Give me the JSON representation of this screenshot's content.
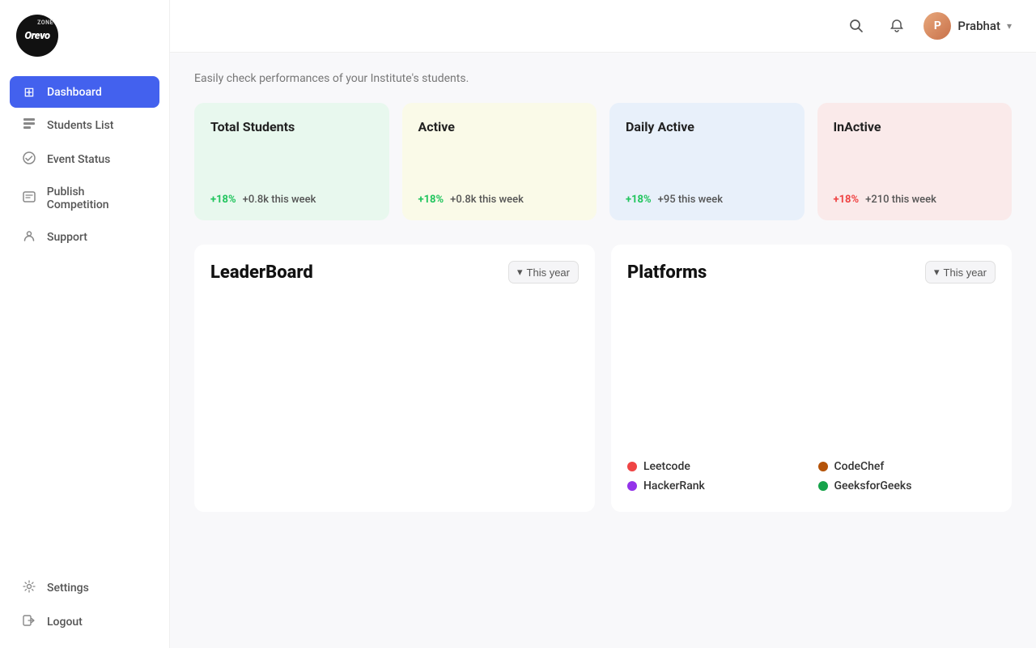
{
  "logo": {
    "text": "Orevo",
    "zone": "ZONE"
  },
  "sidebar": {
    "items": [
      {
        "id": "dashboard",
        "label": "Dashboard",
        "icon": "⊞",
        "active": true
      },
      {
        "id": "students-list",
        "label": "Students List",
        "icon": "≡",
        "active": false
      },
      {
        "id": "event-status",
        "label": "Event Status",
        "icon": "✓",
        "active": false
      },
      {
        "id": "publish-competition",
        "label": "Publish Competition",
        "icon": "▤",
        "active": false
      },
      {
        "id": "support",
        "label": "Support",
        "icon": "👤",
        "active": false
      }
    ],
    "bottom": [
      {
        "id": "settings",
        "label": "Settings",
        "icon": "⚙"
      },
      {
        "id": "logout",
        "label": "Logout",
        "icon": "⇥"
      }
    ]
  },
  "header": {
    "username": "Prabhat",
    "search_title": "Search",
    "bell_title": "Notifications"
  },
  "content": {
    "subtitle": "Easily check performances of your Institute's students.",
    "stats": [
      {
        "id": "total-students",
        "title": "Total Students",
        "pct": "+18%",
        "pct_color": "green",
        "desc": "+0.8k this week",
        "bg": "green"
      },
      {
        "id": "active",
        "title": "Active",
        "pct": "+18%",
        "pct_color": "green",
        "desc": "+0.8k this week",
        "bg": "yellow"
      },
      {
        "id": "daily-active",
        "title": "Daily Active",
        "pct": "+18%",
        "pct_color": "green",
        "desc": "+95 this week",
        "bg": "blue"
      },
      {
        "id": "inactive",
        "title": "InActive",
        "pct": "+18%",
        "pct_color": "red",
        "desc": "+210 this week",
        "bg": "pink"
      }
    ],
    "leaderboard": {
      "title": "LeaderBoard",
      "year_label": "This year"
    },
    "platforms": {
      "title": "Platforms",
      "year_label": "This year",
      "legend": [
        {
          "label": "Leetcode",
          "color": "#ef4444"
        },
        {
          "label": "CodeChef",
          "color": "#b45309"
        },
        {
          "label": "HackerRank",
          "color": "#9333ea"
        },
        {
          "label": "GeeksforGeeks",
          "color": "#16a34a"
        }
      ]
    }
  }
}
